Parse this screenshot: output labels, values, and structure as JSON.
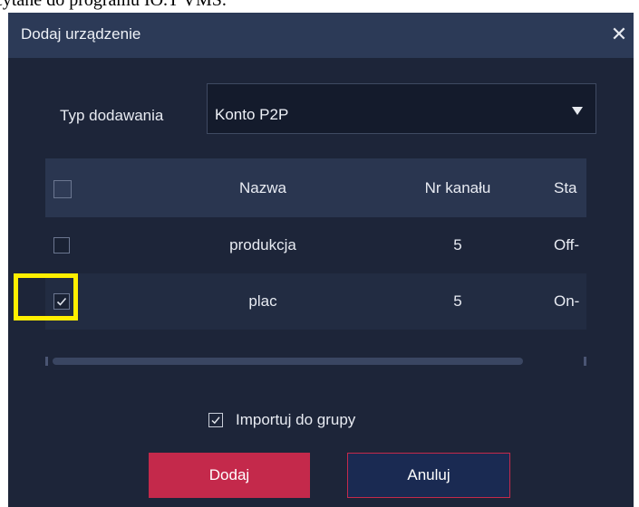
{
  "caption": "cytane do programu IO.T VMS.",
  "dialog": {
    "title": "Dodaj urządzenie",
    "close_glyph": "✕",
    "type_label": "Typ dodawania",
    "type_value": "Konto P2P"
  },
  "table": {
    "columns": [
      "Nazwa",
      "Nr kanału",
      "Sta"
    ],
    "rows": [
      {
        "name": "produkcja",
        "channel": "5",
        "status": "Off-",
        "checked": false
      },
      {
        "name": "plac",
        "channel": "5",
        "status": "On-",
        "checked": true
      }
    ]
  },
  "import_label": "Importuj do grupy",
  "import_checked": true,
  "buttons": {
    "add": "Dodaj",
    "cancel": "Anuluj"
  },
  "colors": {
    "highlight": "#ffef00",
    "accent": "#c4294b"
  }
}
